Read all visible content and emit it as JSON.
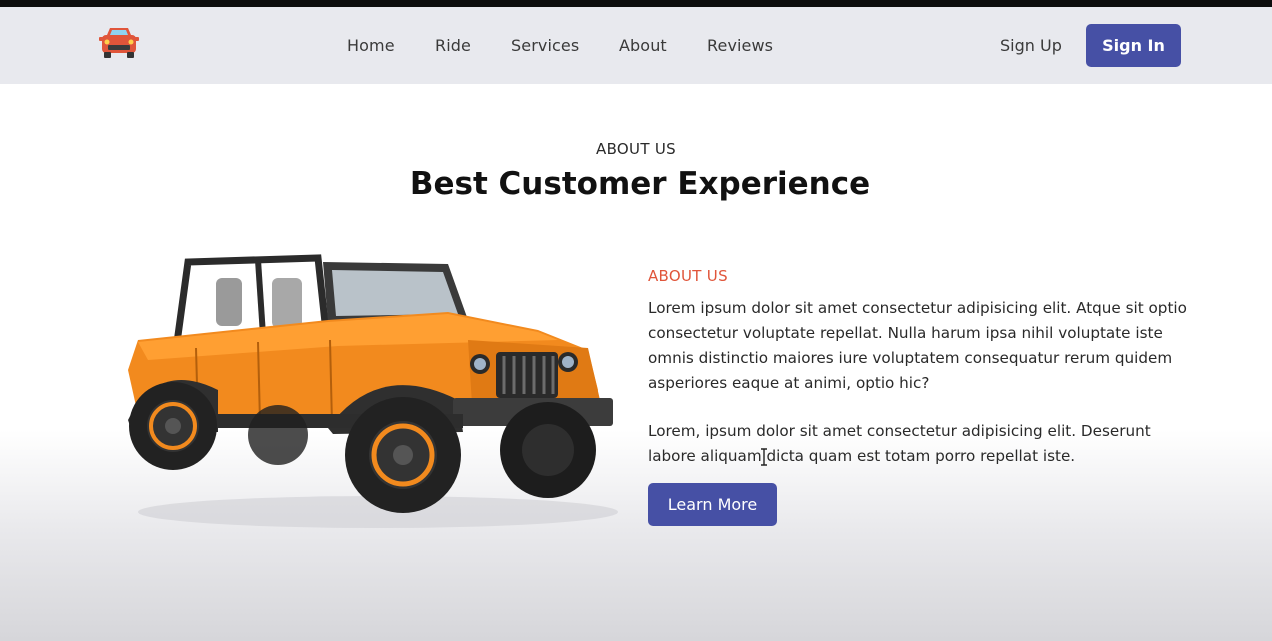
{
  "navbar": {
    "logo_icon": "car-logo-icon",
    "links": [
      "Home",
      "Ride",
      "Services",
      "About",
      "Reviews"
    ],
    "sign_up": "Sign Up",
    "sign_in": "Sign In"
  },
  "hero": {
    "eyebrow": "ABOUT US",
    "headline": "Best Customer Experience"
  },
  "about": {
    "label": "ABOUT US",
    "paragraph1": "Lorem ipsum dolor sit amet consectetur adipisicing elit. Atque sit optio consectetur voluptate repellat. Nulla harum ipsa nihil voluptate iste omnis distinctio maiores iure voluptatem consequatur rerum quidem asperiores eaque at animi, optio hic?",
    "paragraph2": "Lorem, ipsum dolor sit amet consectetur adipisicing elit. Deserunt labore aliquam dicta quam est totam porro repellat iste.",
    "button": "Learn More",
    "image_icon": "orange-jeep-image"
  },
  "colors": {
    "accent": "#4650a5",
    "label": "#e0553a",
    "navbar_bg": "#e8e9ee"
  }
}
